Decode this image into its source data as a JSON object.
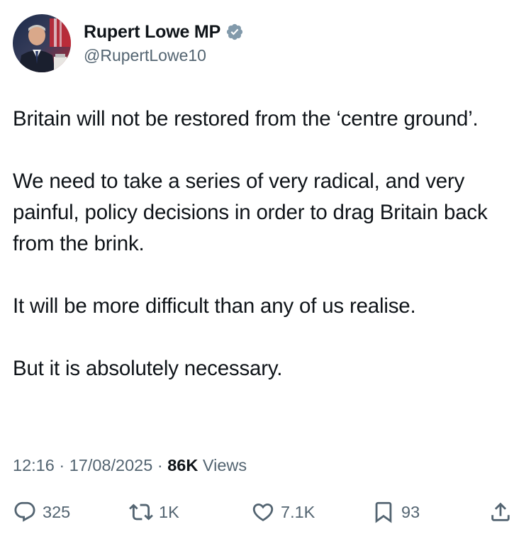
{
  "author": {
    "display_name": "Rupert Lowe MP",
    "handle": "@RupertLowe10",
    "verified": true,
    "verified_color": "#829aab",
    "avatar_icon": "profile-photo"
  },
  "tweet": {
    "paragraphs": [
      "Britain will not be restored from the ‘centre ground’.",
      "We need to take a series of very radical, and very painful, policy decisions in order to drag Britain back from the brink.",
      "It will be more difficult than any of us realise.",
      "But it is absolutely necessary."
    ]
  },
  "meta": {
    "time": "12:16",
    "separator": " · ",
    "date": "17/08/2025",
    "views_count": "86K",
    "views_label": " Views"
  },
  "actions": {
    "reply": {
      "icon": "reply-icon",
      "count": "325"
    },
    "repost": {
      "icon": "repost-icon",
      "count": "1K"
    },
    "like": {
      "icon": "heart-icon",
      "count": "7.1K"
    },
    "bookmark": {
      "icon": "bookmark-icon",
      "count": "93"
    },
    "share": {
      "icon": "share-icon"
    }
  },
  "colors": {
    "text": "#0f1419",
    "secondary": "#536471",
    "background": "#ffffff"
  }
}
